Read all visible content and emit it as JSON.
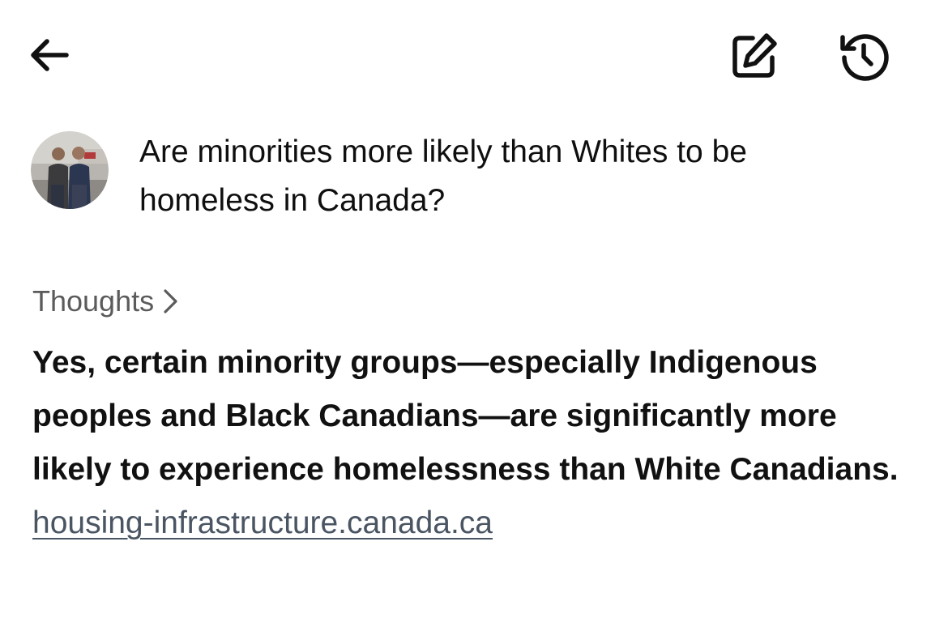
{
  "header": {
    "back_icon": "arrow-left-icon",
    "edit_icon": "pencil-square-icon",
    "history_icon": "history-clock-icon"
  },
  "user_message": {
    "avatar_icon": "user-avatar-photo",
    "text": "Are minorities more likely than Whites to be homeless in Canada?"
  },
  "thoughts": {
    "label": "Thoughts",
    "chevron_icon": "chevron-right-icon"
  },
  "answer": {
    "text": "Yes, certain minority groups—especially Indigenous peoples and Black Canadians—are significantly more likely to experience homelessness than White Canadians.",
    "source_link": "housing-infrastructure.canada.ca"
  },
  "colors": {
    "text": "#111111",
    "muted": "#5b5b5b",
    "link": "#4a5563",
    "background": "#ffffff"
  }
}
